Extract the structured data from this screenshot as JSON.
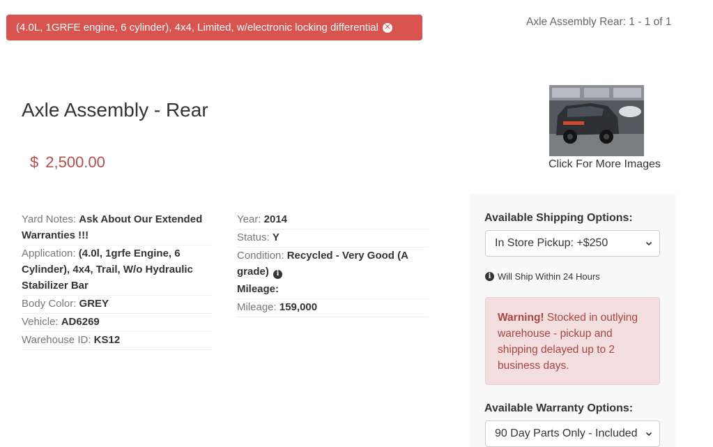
{
  "filter": {
    "label": "(4.0L, 1GRFE engine, 6 cylinder), 4x4, Limited, w/electronic locking differential",
    "remove_icon": "times-circle-icon"
  },
  "results": {
    "count_text": "Axle Assembly Rear: 1 - 1 of 1"
  },
  "product": {
    "title": "Axle Assembly - Rear",
    "price_symbol": "$",
    "price_amount": "2,500.00",
    "image_alt": "vehicle photo",
    "more_images_label": "Click For More Images"
  },
  "details_left": [
    {
      "label": "Yard Notes:",
      "value": "Ask About Our Extended Warranties !!!"
    },
    {
      "label": "Application:",
      "value": "(4.0l, 1grfe Engine, 6 Cylinder), 4x4, Trail, W/o Hydraulic Stabilizer Bar"
    },
    {
      "label": "Body Color:",
      "value": "GREY"
    },
    {
      "label": "Vehicle:",
      "value": "AD6269"
    },
    {
      "label": "Warehouse ID:",
      "value": "KS12"
    }
  ],
  "details_right": {
    "year_label": "Year:",
    "year_value": "2014",
    "status_label": "Status:",
    "status_value": "Y",
    "condition_label": "Condition:",
    "condition_value": "Recycled - Very Good (A grade)",
    "mileage_heading": "Mileage:",
    "mileage_label": "Mileage:",
    "mileage_value": "159,000"
  },
  "shipping": {
    "label": "Available Shipping Options:",
    "selected": "In Store Pickup: +$250",
    "note": "Will Ship Within 24 Hours"
  },
  "warning": {
    "title": "Warning!",
    "text": "Stocked in outlying warehouse - pickup and shipping delayed up to 2 business days."
  },
  "warranty": {
    "label": "Available Warranty Options:",
    "selected": "90 Day Parts Only - Included"
  },
  "colors": {
    "filter_bg": "#d9534f",
    "price": "#b94a48",
    "alert_bg": "#f2dede",
    "alert_text": "#a94442"
  },
  "icons": {
    "info": "info-circle-icon",
    "chevron": "chevron-down-icon"
  }
}
